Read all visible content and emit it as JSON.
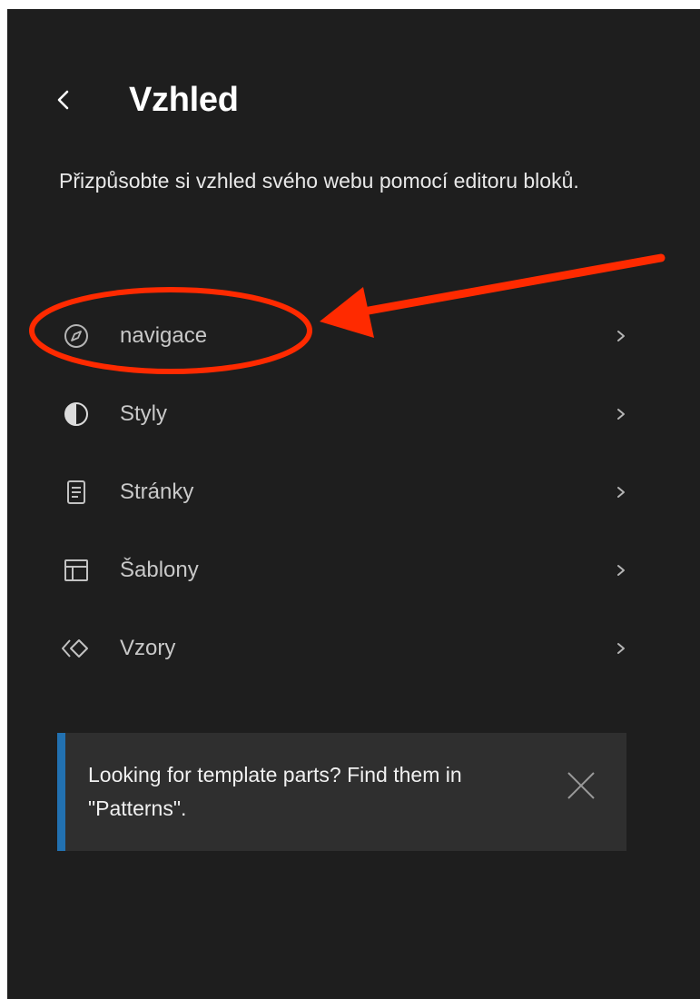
{
  "header": {
    "back_icon": "chevron-left-icon",
    "title": "Vzhled"
  },
  "description": "Přizpůsobte si vzhled svého webu pomocí editoru bloků.",
  "nav": {
    "items": [
      {
        "label": "navigace",
        "icon": "compass-icon"
      },
      {
        "label": "Styly",
        "icon": "half-circle-icon"
      },
      {
        "label": "Stránky",
        "icon": "page-icon"
      },
      {
        "label": "Šablony",
        "icon": "layout-icon"
      },
      {
        "label": "Vzory",
        "icon": "symbol-icon"
      }
    ],
    "chevron_icon": "chevron-right-icon"
  },
  "notice": {
    "text": "Looking for template parts? Find them in \"Patterns\".",
    "close_icon": "close-icon",
    "accent_color": "#2271b1"
  },
  "colors": {
    "panel_background": "#1e1e1e",
    "annotation": "#ff2a00"
  }
}
